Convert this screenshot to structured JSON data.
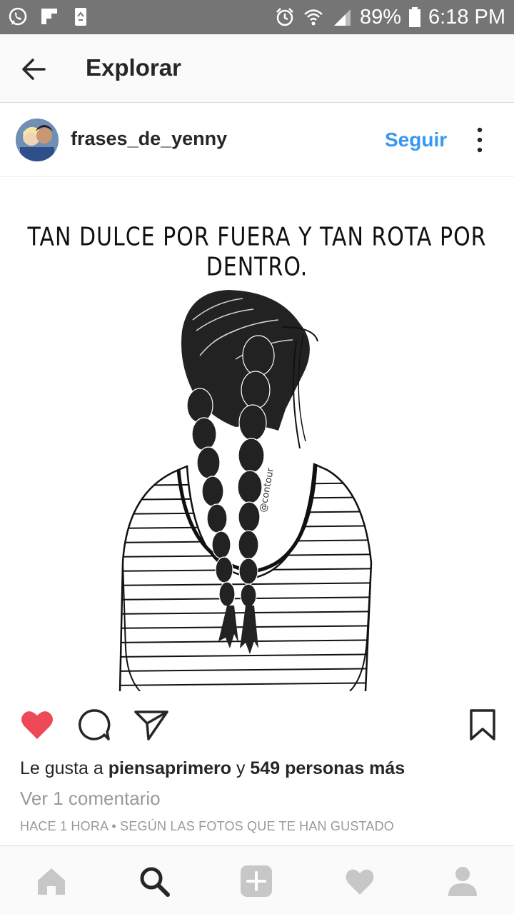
{
  "statusbar": {
    "battery": "89%",
    "time": "6:18 PM",
    "icons": [
      "whatsapp-icon",
      "flipboard-icon",
      "recycle-icon",
      "alarm-icon",
      "wifi-icon",
      "signal-icon",
      "battery-icon"
    ]
  },
  "header": {
    "title": "Explorar",
    "back_icon": "arrow-left-icon"
  },
  "post": {
    "username": "frases_de_yenny",
    "follow_label": "Seguir",
    "image_quote": "TAN DULCE POR FUERA Y TAN ROTA POR DENTRO.",
    "liked": true,
    "likes_prefix": "Le gusta a ",
    "likes_user": "piensaprimero",
    "likes_mid": " y ",
    "likes_count": "549 personas más",
    "comments_link": "Ver 1 comentario",
    "timestamp": "HACE 1 HORA • SEGÚN LAS FOTOS QUE TE HAN GUSTADO"
  },
  "colors": {
    "accent": "#3897f0",
    "like": "#ed4956",
    "statusbar": "#757575",
    "nav_inactive": "#c7c7c7"
  },
  "bottom_nav": [
    "home-icon",
    "search-icon",
    "add-icon",
    "heart-icon",
    "profile-icon"
  ]
}
